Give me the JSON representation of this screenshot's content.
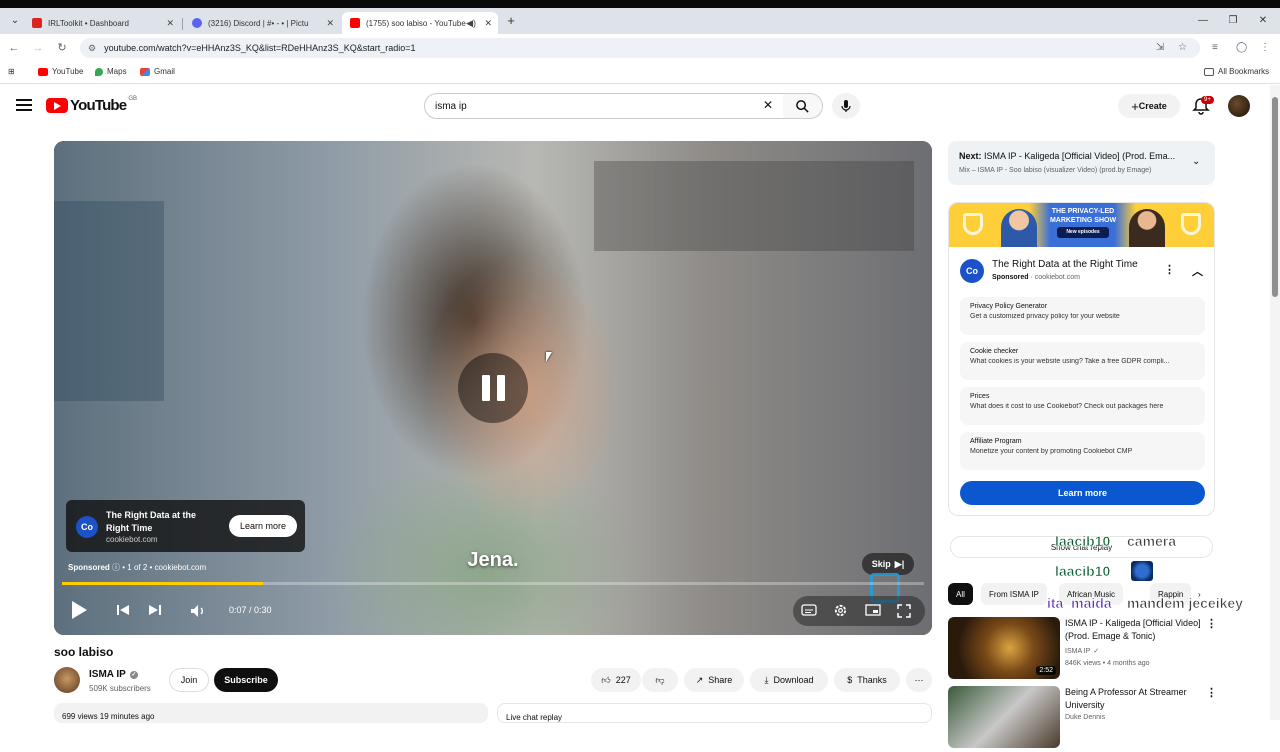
{
  "browser": {
    "tabs": [
      {
        "title": "IRLToolkit • Dashboard",
        "active": false
      },
      {
        "title": "(3216) Discord | #• ‐ • | Pictu",
        "active": false
      },
      {
        "title": "(1755) soo labiso - YouTube",
        "active": true
      }
    ],
    "new_tab": "+",
    "url": "youtube.com/watch?v=eHHAnz3S_KQ&list=RDeHHAnz3S_KQ&start_radio=1",
    "bookmarks": [
      "YouTube",
      "Maps",
      "Gmail"
    ],
    "all_bookmarks": "All Bookmarks"
  },
  "header": {
    "logo_text": "YouTube",
    "region": "GB",
    "search_value": "isma ip",
    "create_label": "Create",
    "notifications_badge": "9+"
  },
  "player": {
    "subtitle": "Jena.",
    "ad_card": {
      "title": "The Right Data at the Right Time",
      "domain": "cookiebot.com",
      "cta": "Learn more",
      "logo": "Co"
    },
    "sponsored": "Sponsored",
    "ad_count": "1 of 2",
    "ad_domain": "cookiebot.com",
    "skip_label": "Skip",
    "time": "0:07 / 0:30",
    "progress": 0.233
  },
  "video": {
    "title": "soo labiso",
    "channel": "ISMA IP",
    "subscribers": "509K subscribers",
    "join": "Join",
    "subscribe": "Subscribe",
    "likes": "227",
    "share": "Share",
    "download": "Download",
    "thanks": "Thanks",
    "meta": "699 views  19 minutes ago",
    "live_chat": "Live chat replay"
  },
  "sidebar": {
    "next_label": "Next:",
    "next_title": "ISMA IP - Kaligeda [Official Video] (Prod. Ema...",
    "next_mix": "Mix – ISMA IP - Soo labiso (visualizer Video) (prod.by Emage)",
    "ad": {
      "banner_line1": "THE PRIVACY-LED",
      "banner_line2": "MARKETING SHOW",
      "banner_sub": "New episodes",
      "title": "The Right Data at the Right Time",
      "sponsored": "Sponsored",
      "domain": "· cookiebot.com",
      "logo": "Co",
      "rows": [
        {
          "title": "Privacy Policy Generator",
          "desc": "Get a customized privacy policy for your website"
        },
        {
          "title": "Cookie checker",
          "desc": "What cookies is your website using? Take a free GDPR compli..."
        },
        {
          "title": "Prices",
          "desc": "What does it cost to use Cookiebot? Check out packages here"
        },
        {
          "title": "Affiliate Program",
          "desc": "Monetize your content by promoting Cookiebot CMP"
        }
      ],
      "cta": "Learn more"
    },
    "show_chat_replay": "Show chat replay",
    "chips": [
      "All",
      "From ISMA IP",
      "African Music",
      "Rappin"
    ],
    "recommendations": [
      {
        "title": "ISMA IP - Kaligeda [Official Video] (Prod. Emage & Tonic)",
        "channel": "ISMA IP",
        "meta": "846K views • 4 months ago",
        "duration": "2:52"
      },
      {
        "title": "Being A Professor At Streamer University",
        "channel": "Duke Dennis",
        "meta": "",
        "duration": ""
      }
    ]
  },
  "stream_overlay": {
    "messages": [
      {
        "user": "laacib10",
        "text": "camera"
      },
      {
        "user": "laacib10",
        "text": ""
      },
      {
        "user": "ita_maida",
        "text": "mandem jeceikey"
      }
    ]
  },
  "colors": {
    "yt_red": "#ff0000",
    "progress": "#ffcc00",
    "cta_blue": "#0b57d0"
  }
}
